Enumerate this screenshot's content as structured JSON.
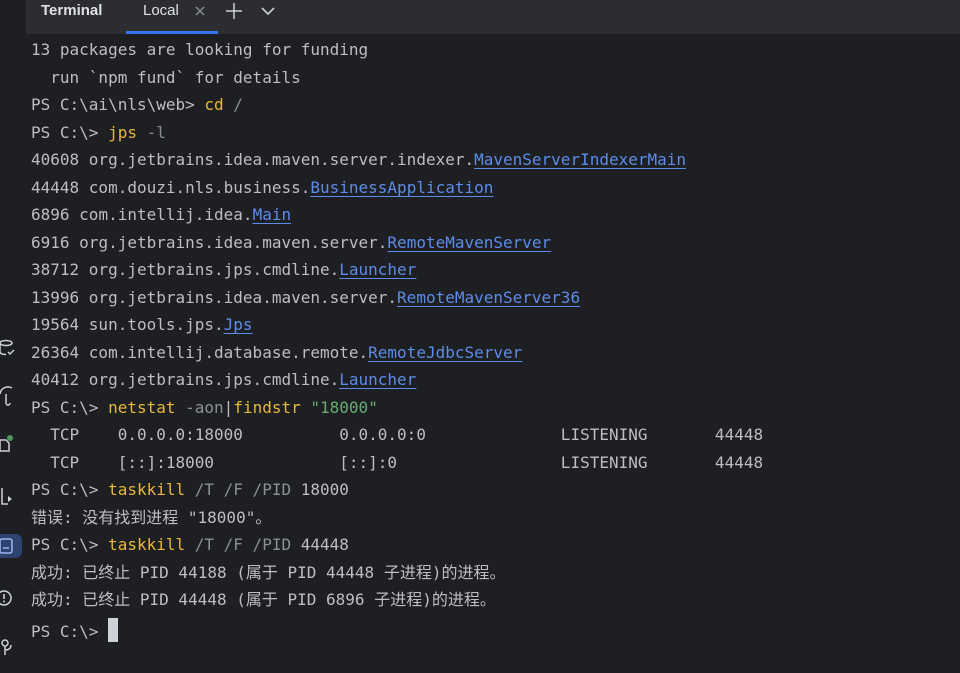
{
  "tabs": {
    "title": "Terminal",
    "local_label": "Local",
    "close_icon": "close-icon",
    "add_icon": "plus-icon",
    "menu_icon": "chevron-down-icon"
  },
  "sidebar": {
    "icons": [
      "database-icon",
      "umbrella-icon",
      "plugin-icon",
      "run-icon",
      "terminal-icon",
      "problems-icon",
      "git-icon"
    ]
  },
  "colors": {
    "background": "#1e1f22",
    "tabbar": "#2b2d30",
    "text": "#bcbec4",
    "command": "#e8b83c",
    "argument": "#8c8f96",
    "string": "#6aab73",
    "link": "#5c8ce8",
    "tab_underline": "#3574f0"
  },
  "terminal": {
    "prompt_ps": "PS",
    "lines": {
      "funding": "13 packages are looking for funding",
      "fund_hint": "  run `npm fund` for details",
      "l3_prompt": "PS C:\\ai\\nls\\web> ",
      "l3_cmd": "cd",
      "l3_arg": " /",
      "l4_prompt": "PS C:\\> ",
      "l4_cmd": "jps",
      "l4_arg": " -l",
      "jps": [
        {
          "pid": "40608 ",
          "pkg": "org.jetbrains.idea.maven.server.indexer.",
          "cls": "MavenServerIndexerMain"
        },
        {
          "pid": "44448 ",
          "pkg": "com.douzi.nls.business.",
          "cls": "BusinessApplication"
        },
        {
          "pid": "6896 ",
          "pkg": "com.intellij.idea.",
          "cls": "Main"
        },
        {
          "pid": "6916 ",
          "pkg": "org.jetbrains.idea.maven.server.",
          "cls": "RemoteMavenServer"
        },
        {
          "pid": "38712 ",
          "pkg": "org.jetbrains.jps.cmdline.",
          "cls": "Launcher"
        },
        {
          "pid": "13996 ",
          "pkg": "org.jetbrains.idea.maven.server.",
          "cls": "RemoteMavenServer36"
        },
        {
          "pid": "19564 ",
          "pkg": "sun.tools.jps.",
          "cls": "Jps"
        },
        {
          "pid": "26364 ",
          "pkg": "com.intellij.database.remote.",
          "cls": "RemoteJdbcServer"
        },
        {
          "pid": "40412 ",
          "pkg": "org.jetbrains.jps.cmdline.",
          "cls": "Launcher"
        }
      ],
      "l14_prompt": "PS C:\\> ",
      "l14_cmd": "netstat",
      "l14_arg": " -aon",
      "l14_pipe": "|",
      "l14_cmd2": "findstr",
      "l14_space": " ",
      "l14_str": "\"18000\"",
      "tcp1": "  TCP    0.0.0.0:18000          0.0.0.0:0              LISTENING       44448",
      "tcp2": "  TCP    [::]:18000             [::]:0                 LISTENING       44448",
      "l17_prompt": "PS C:\\> ",
      "l17_cmd": "taskkill",
      "l17_arg": " /T /F /PID",
      "l17_val": " 18000",
      "err": "错误: 没有找到进程 \"18000\"。",
      "l19_prompt": "PS C:\\> ",
      "l19_cmd": "taskkill",
      "l19_arg": " /T /F /PID",
      "l19_val": " 44448",
      "ok1": "成功: 已终止 PID 44188 (属于 PID 44448 子进程)的进程。",
      "ok2": "成功: 已终止 PID 44448 (属于 PID 6896 子进程)的进程。",
      "l22_prompt": "PS C:\\> "
    }
  }
}
